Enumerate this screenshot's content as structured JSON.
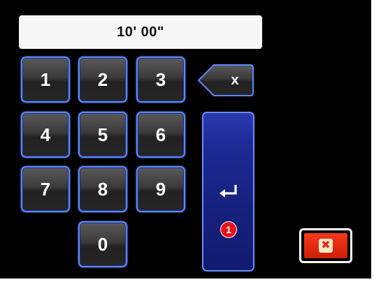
{
  "display": {
    "value": "10' 00\""
  },
  "keypad": {
    "keys": [
      "1",
      "2",
      "3",
      "4",
      "5",
      "6",
      "7",
      "8",
      "9",
      "0"
    ]
  },
  "backspace": {
    "label": "x",
    "icon": "backspace-icon"
  },
  "enter": {
    "icon": "enter-icon",
    "badge": "1"
  },
  "close": {
    "icon": "close-icon",
    "glyph": "✖"
  },
  "colors": {
    "screen_bg": "#000000",
    "key_border": "#5d86ff",
    "enter_bg": "#1e2a95",
    "badge_red": "#e8141c",
    "close_red": "#e42b10"
  }
}
